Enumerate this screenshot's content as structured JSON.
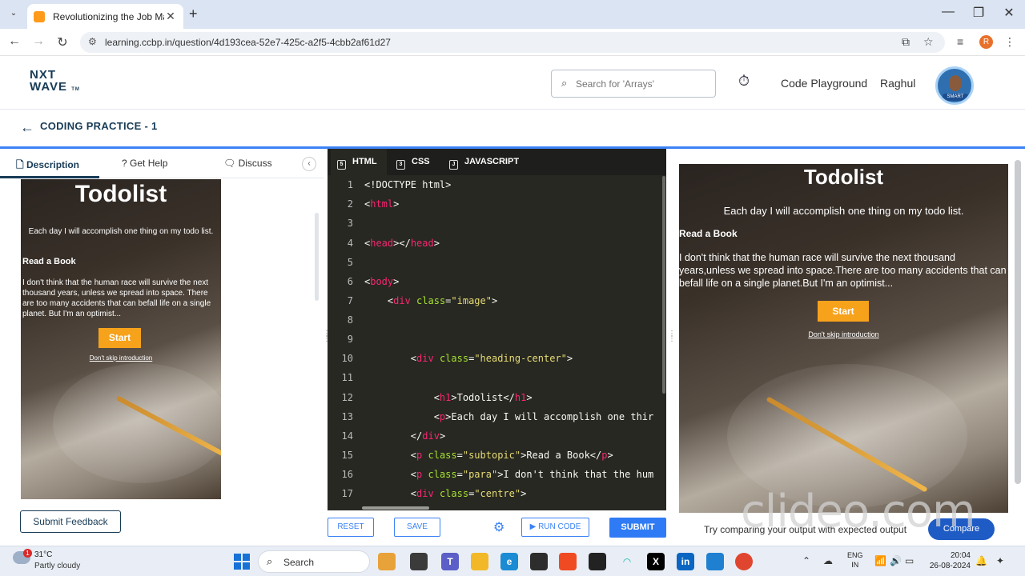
{
  "browser": {
    "tab_title": "Revolutionizing the Job Market",
    "tab_close": "✕",
    "new_tab": "+",
    "url": "learning.ccbp.in/question/4d193cea-52e7-425c-a2f5-4cbb2af61d27",
    "profile_letter": "R"
  },
  "header": {
    "logo_line1": "NXT",
    "logo_line2": "WAVE",
    "logo_tm": "TM",
    "search_placeholder": "Search for 'Arrays'",
    "code_playground": "Code Playground",
    "user_name": "Raghul",
    "profile_badge": "SMART"
  },
  "practice": {
    "title": "CODING PRACTICE - 1"
  },
  "left_tabs": {
    "description": "Description",
    "get_help": "Get Help",
    "discuss": "Discuss"
  },
  "preview": {
    "heading": "Todolist",
    "intro": "Each day I will accomplish one thing on my todo list.",
    "subtopic": "Read a Book",
    "para_small": "I don't think that the human race will survive the next thousand years, unless we spread into space. There are too many accidents that can befall life on a single planet. But I'm an optimist...",
    "para_large": "I don't think that the human race will survive the next thousand years,unless we spread into space.There are too many accidents that can befall life on a single planet.But I'm an optimist...",
    "start": "Start",
    "skip": "Don't skip introduction"
  },
  "editor": {
    "tabs": [
      "HTML",
      "CSS",
      "JAVASCRIPT"
    ],
    "line_numbers": [
      "1",
      "2",
      "3",
      "4",
      "5",
      "6",
      "7",
      "8",
      "9",
      "10",
      "11",
      "12",
      "13",
      "14",
      "15",
      "16",
      "17"
    ]
  },
  "bottom": {
    "submit_feedback": "Submit Feedback",
    "reset": "RESET",
    "save": "SAVE",
    "run_code": "RUN CODE",
    "submit": "SUBMIT",
    "try_compare": "Try comparing your output with expected output",
    "compare": "Compare",
    "watermark": "clideo.com"
  },
  "taskbar": {
    "weather_badge": "1",
    "temperature": "31°C",
    "condition": "Partly cloudy",
    "search": "Search",
    "lang1": "ENG",
    "lang2": "IN",
    "time": "20:04",
    "date": "26-08-2024"
  },
  "colors": {
    "accent": "#3b82f6",
    "brand_dark": "#183b56",
    "start_button": "#f7a21b",
    "editor_bg": "#272822"
  }
}
